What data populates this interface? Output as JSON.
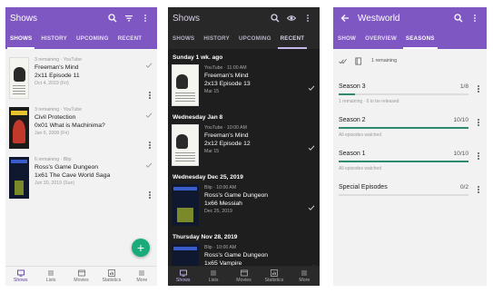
{
  "colors": {
    "primary": "#7e57c2",
    "accent": "#1aab7a",
    "progress": "#2d8a6e",
    "dark_bg": "#1e1e1e"
  },
  "panel1": {
    "title": "Shows",
    "tabs": [
      "SHOWS",
      "HISTORY",
      "UPCOMING",
      "RECENT"
    ],
    "active_tab": 0,
    "shows": [
      {
        "meta": "3 remaining · YouTube",
        "name": "Freeman's Mind",
        "episode": "2x11 Episode 11",
        "date": "Oct 4, 2019 (Fri)",
        "poster": "freemans-mind-poster"
      },
      {
        "meta": "3 remaining · YouTube",
        "name": "Civil Protection",
        "episode": "0x01 What is Machinima?",
        "date": "Jan 6, 2008 (Fri)",
        "poster": "civil-protection-poster"
      },
      {
        "meta": "6 remaining · Blip",
        "name": "Ross's Game Dungeon",
        "episode": "1x61 The Cave World Saga",
        "date": "Jun 30, 2019 (Sun)",
        "poster": "ross-game-dungeon-poster"
      }
    ],
    "fab": "+"
  },
  "panel2": {
    "title": "Shows",
    "tabs": [
      "SHOWS",
      "HISTORY",
      "UPCOMING",
      "RECENT"
    ],
    "active_tab": 3,
    "groups": [
      {
        "day": "Sunday 1 wk. ago",
        "meta": "YouTube · 11:00 AM",
        "name": "Freeman's Mind",
        "episode": "2x13 Episode 13",
        "date": "Mar 15"
      },
      {
        "day": "Wednesday Jan 8",
        "meta": "YouTube · 10:00 AM",
        "name": "Freeman's Mind",
        "episode": "2x12 Episode 12",
        "date": "Mar 15"
      },
      {
        "day": "Wednesday Dec 25, 2019",
        "meta": "Blip · 10:00 AM",
        "name": "Ross's Game Dungeon",
        "episode": "1x66 Messiah",
        "date": "Dec 25, 2019"
      },
      {
        "day": "Thursday Nov 28, 2019",
        "meta": "Blip · 10:00 AM",
        "name": "Ross's Game Dungeon",
        "episode": "1x65 Vampire",
        "date": ""
      }
    ]
  },
  "panel3": {
    "title": "Westworld",
    "tabs": [
      "SHOW",
      "OVERVIEW",
      "SEASONS"
    ],
    "active_tab": 2,
    "remaining": "1 remaining",
    "seasons": [
      {
        "name": "Season 3",
        "count": "1/8",
        "note": "1 remaining · 6 to be released",
        "progress": 0.125
      },
      {
        "name": "Season 2",
        "count": "10/10",
        "note": "All episodes watched",
        "progress": 1.0
      },
      {
        "name": "Season 1",
        "count": "10/10",
        "note": "All episodes watched",
        "progress": 1.0
      },
      {
        "name": "Special Episodes",
        "count": "0/2",
        "note": "",
        "progress": 0.0
      }
    ]
  },
  "bottomnav": [
    "Shows",
    "Lists",
    "Movies",
    "Statistics",
    "More"
  ]
}
